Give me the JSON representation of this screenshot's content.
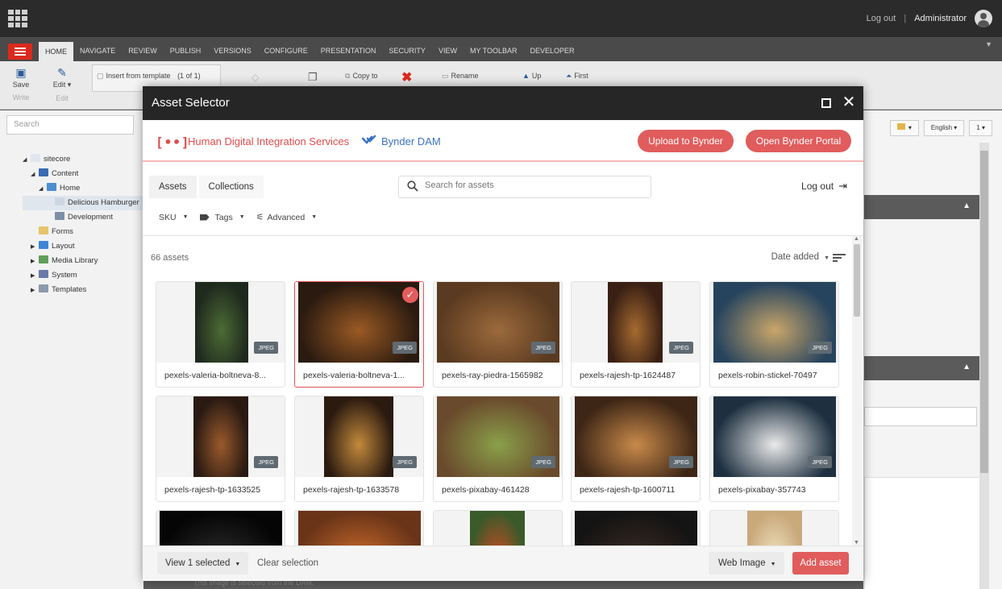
{
  "topbar": {
    "logout": "Log out",
    "separator": "|",
    "user": "Administrator"
  },
  "ribbon_tabs": [
    "HOME",
    "NAVIGATE",
    "REVIEW",
    "PUBLISH",
    "VERSIONS",
    "CONFIGURE",
    "PRESENTATION",
    "SECURITY",
    "VIEW",
    "MY TOOLBAR",
    "DEVELOPER"
  ],
  "ribbon": {
    "save": "Save",
    "write": "Write",
    "edit": "Edit ▾",
    "edit_sub": "Edit",
    "insert_template": "Insert from template",
    "insert_count": "(1 of 1)",
    "copy_to": "Copy to",
    "rename": "Rename",
    "up": "Up",
    "first": "First"
  },
  "left": {
    "search_placeholder": "Search",
    "tree": [
      {
        "label": "sitecore",
        "toggle": "◢",
        "color": "#dfe6f0"
      },
      {
        "label": "Content",
        "toggle": "◢",
        "color": "#3a6bb5"
      },
      {
        "label": "Home",
        "toggle": "◢",
        "color": "#4b8fd0"
      },
      {
        "label": "Delicious Hamburger",
        "toggle": "",
        "color": "#cdd7e3"
      },
      {
        "label": "Development",
        "toggle": "",
        "color": "#7c8fa6"
      },
      {
        "label": "Forms",
        "toggle": "",
        "color": "#e6c46a"
      },
      {
        "label": "Layout",
        "toggle": "▶",
        "color": "#3f86d6"
      },
      {
        "label": "Media Library",
        "toggle": "▶",
        "color": "#5f9e5a"
      },
      {
        "label": "System",
        "toggle": "▶",
        "color": "#6a7aa8"
      },
      {
        "label": "Templates",
        "toggle": "▶",
        "color": "#8a9aa8"
      }
    ]
  },
  "right": {
    "lang": "English ▾",
    "version": "1 ▾",
    "flag": "▾"
  },
  "bottom_note": "This image is selected from the DAM.",
  "modal": {
    "title": "Asset Selector",
    "brand_logo": "[••]",
    "brand_name": "Human Digital Integration Services",
    "dam_name": "Bynder DAM",
    "upload_label": "Upload to Bynder",
    "portal_label": "Open Bynder Portal",
    "tabs": [
      "Assets",
      "Collections"
    ],
    "search_placeholder": "Search for assets",
    "logout_label": "Log out",
    "filters": {
      "sku": "SKU",
      "tags": "Tags",
      "advanced": "Advanced"
    },
    "count_label": "66 assets",
    "sort_label": "Date added",
    "assets": [
      {
        "name": "pexels-valeria-boltneva-8...",
        "type": "JPEG",
        "selected": false
      },
      {
        "name": "pexels-valeria-boltneva-1...",
        "type": "JPEG",
        "selected": true
      },
      {
        "name": "pexels-ray-piedra-1565982",
        "type": "JPEG",
        "selected": false
      },
      {
        "name": "pexels-rajesh-tp-1624487",
        "type": "JPEG",
        "selected": false
      },
      {
        "name": "pexels-robin-stickel-70497",
        "type": "JPEG",
        "selected": false
      },
      {
        "name": "pexels-rajesh-tp-1633525",
        "type": "JPEG",
        "selected": false
      },
      {
        "name": "pexels-rajesh-tp-1633578",
        "type": "JPEG",
        "selected": false
      },
      {
        "name": "pexels-pixabay-461428",
        "type": "JPEG",
        "selected": false
      },
      {
        "name": "pexels-rajesh-tp-1600711",
        "type": "JPEG",
        "selected": false
      },
      {
        "name": "pexels-pixabay-357743",
        "type": "JPEG",
        "selected": false
      }
    ],
    "view_selected_label": "View 1 selected",
    "clear_selection_label": "Clear selection",
    "format_label": "Web Image",
    "add_label": "Add asset"
  },
  "colors": {
    "accent": "#e15c5c",
    "brand": "#e14b4a",
    "bynder_blue": "#3c72c5",
    "sitecore_red": "#dc291e"
  }
}
